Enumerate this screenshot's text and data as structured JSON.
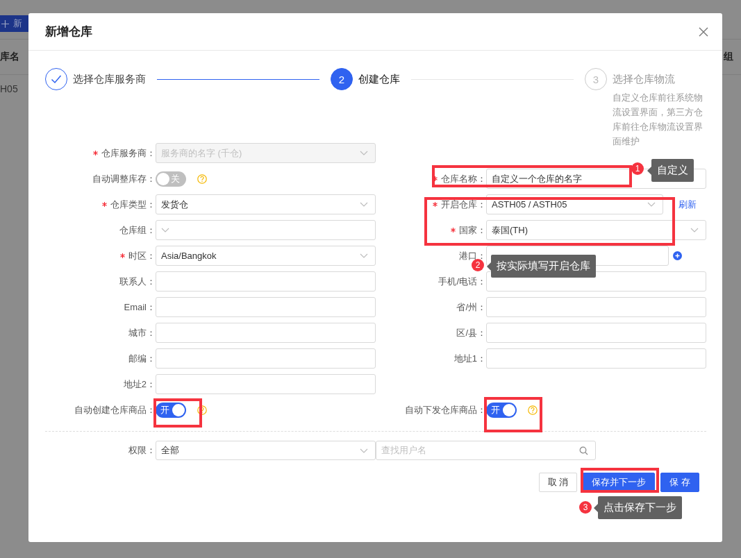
{
  "page": {
    "add_button": "新",
    "column_1": "库名",
    "cell": "H05",
    "column_2": "组"
  },
  "dialog": {
    "title": "新增仓库"
  },
  "steps": [
    {
      "label": "选择仓库服务商",
      "done": true,
      "selected": false
    },
    {
      "label": "创建仓库",
      "number": "2",
      "done": false,
      "selected": true
    },
    {
      "label": "选择仓库物流",
      "number": "3",
      "done": false,
      "selected": false,
      "description": "自定义仓库前往系统物流设置界面，第三方仓库前往仓库物流设置界面维护"
    }
  ],
  "form": {
    "rows": [
      {
        "left": {
          "label": "仓库服务商：",
          "required": true,
          "kind": "select",
          "placeholder": "服务商的名字 (千仓)",
          "disabled": true
        }
      },
      {
        "left": {
          "label": "自动调整库存：",
          "required": false,
          "kind": "toggle",
          "on": false,
          "toggle_text": "关",
          "help": true
        },
        "right": {
          "label": "仓库名称：",
          "required": true,
          "kind": "input",
          "value": "自定义一个仓库的名字"
        }
      },
      {
        "left": {
          "label": "仓库类型：",
          "required": true,
          "kind": "select",
          "value": "发货仓"
        },
        "right": {
          "label": "开启仓库：",
          "required": true,
          "kind": "select",
          "value": "ASTH05 / ASTH05",
          "link": "刷新"
        }
      },
      {
        "left": {
          "label": "仓库组：",
          "required": false,
          "kind": "select"
        },
        "right": {
          "label": "国家：",
          "required": true,
          "kind": "select",
          "value": "泰国(TH)"
        }
      },
      {
        "left": {
          "label": "时区：",
          "required": true,
          "kind": "select",
          "value": "Asia/Bangkok"
        },
        "right": {
          "label": "港口：",
          "required": false,
          "kind": "input",
          "add_button": true
        }
      },
      {
        "left": {
          "label": "联系人：",
          "required": false,
          "kind": "input"
        },
        "right": {
          "label": "手机/电话：",
          "required": false,
          "kind": "input"
        }
      },
      {
        "left": {
          "label": "Email：",
          "required": false,
          "kind": "input"
        },
        "right": {
          "label": "省/州：",
          "required": false,
          "kind": "input"
        }
      },
      {
        "left": {
          "label": "城市：",
          "required": false,
          "kind": "input"
        },
        "right": {
          "label": "区/县：",
          "required": false,
          "kind": "input"
        }
      },
      {
        "left": {
          "label": "邮编：",
          "required": false,
          "kind": "input"
        },
        "right": {
          "label": "地址1：",
          "required": false,
          "kind": "input"
        }
      },
      {
        "left": {
          "label": "地址2：",
          "required": false,
          "kind": "input"
        }
      },
      {
        "left": {
          "label": "自动创建仓库商品：",
          "required": false,
          "kind": "toggle",
          "on": true,
          "toggle_text": "开",
          "help": true
        },
        "right": {
          "label": "自动下发仓库商品：",
          "required": false,
          "kind": "toggle",
          "on": true,
          "toggle_text": "开",
          "help": true
        }
      }
    ]
  },
  "permission": {
    "label": "权限：",
    "value": "全部",
    "search_placeholder": "查找用户名"
  },
  "buttons": [
    {
      "label": "取 消",
      "kind": "default"
    },
    {
      "label": "保存并下一步",
      "kind": "primary"
    },
    {
      "label": "保 存",
      "kind": "primary"
    }
  ],
  "annotations": [
    {
      "number": "1",
      "text": "自定义"
    },
    {
      "number": "2",
      "text": "按实际填写开启仓库"
    },
    {
      "number": "3",
      "text": "点击保存下一步"
    }
  ]
}
